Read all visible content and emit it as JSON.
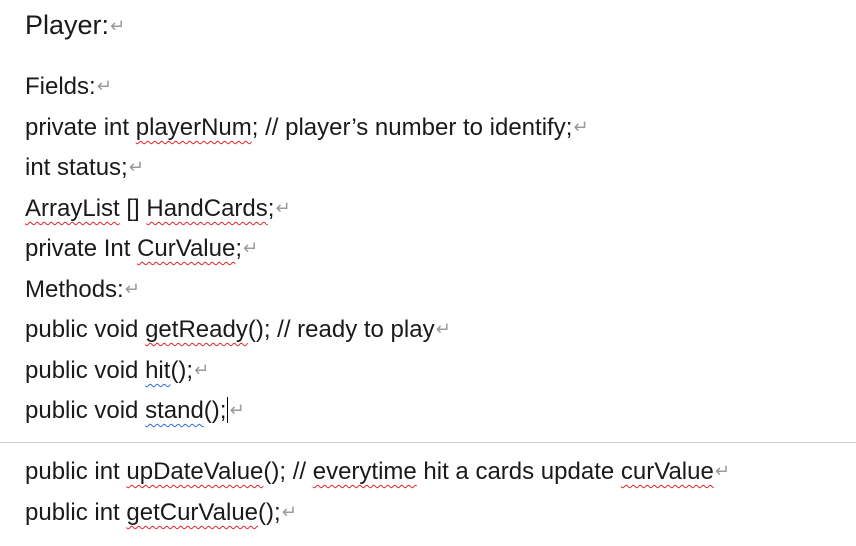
{
  "document": {
    "para_mark": "↵",
    "title": "Player:",
    "fields_heading": "Fields:",
    "field_playerNum": {
      "pre": "private int ",
      "word": "playerNum",
      "post": "; // player’s number to identify;"
    },
    "field_status": "int status;",
    "field_handCards": {
      "w1": "ArrayList",
      "mid": " [] ",
      "w2": "HandCards",
      "post": ";"
    },
    "field_curValue": {
      "pre": "private Int ",
      "word": "CurValue",
      "post": ";"
    },
    "methods_heading": "Methods:",
    "method_getReady": {
      "pre": "public void ",
      "word": "getReady",
      "post": "(); // ready to play"
    },
    "method_hit": {
      "pre": "public void ",
      "word": "hit",
      "post": "();"
    },
    "method_stand": {
      "pre": "public void ",
      "word": "stand",
      "post": "();"
    },
    "method_updateValue": {
      "pre": "public int ",
      "word": "upDateValue",
      "mid1": "(); // ",
      "word2": "everytime",
      "mid2": " hit a cards update ",
      "word3": "curValue"
    },
    "method_getCurValue": {
      "pre": "public int ",
      "word": "getCurValue",
      "post": "();"
    }
  },
  "colors": {
    "spelling_underline": "#e0262a",
    "grammar_underline": "#2f6fd6",
    "paragraph_mark": "#9a9a9a"
  }
}
